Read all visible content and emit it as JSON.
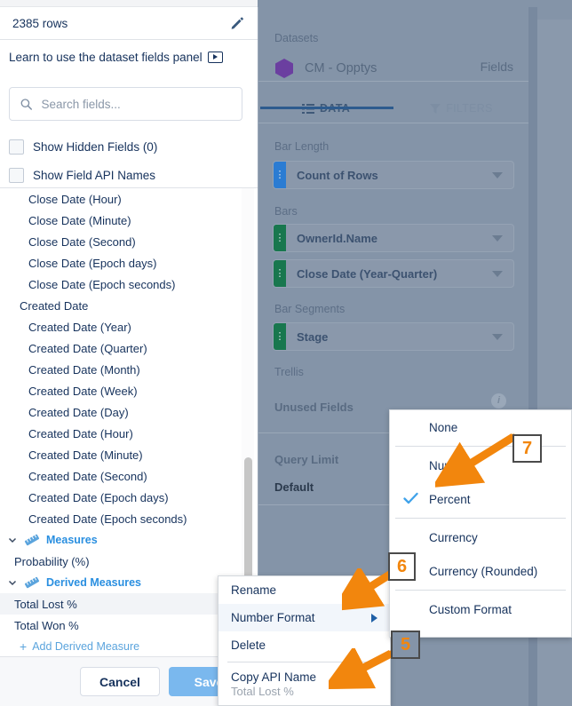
{
  "left_panel": {
    "rows_count": "2385 rows",
    "edit_icon": "pencil-icon",
    "learn_text": "Learn to use the dataset fields panel",
    "video_icon": "play-video-icon",
    "search": {
      "placeholder": "Search fields...",
      "value": "",
      "icon": "search-icon"
    },
    "checkboxes": [
      {
        "label": "Show Hidden Fields (0)",
        "checked": false
      },
      {
        "label": "Show Field API Names",
        "checked": false
      }
    ],
    "field_rows": [
      {
        "label": "Close Date (Hour)",
        "type": "item"
      },
      {
        "label": "Close Date (Minute)",
        "type": "item"
      },
      {
        "label": "Close Date (Second)",
        "type": "item"
      },
      {
        "label": "Close Date (Epoch days)",
        "type": "item"
      },
      {
        "label": "Close Date (Epoch seconds)",
        "type": "item"
      },
      {
        "label": "Created Date",
        "type": "parent"
      },
      {
        "label": "Created Date (Year)",
        "type": "item"
      },
      {
        "label": "Created Date (Quarter)",
        "type": "item"
      },
      {
        "label": "Created Date (Month)",
        "type": "item"
      },
      {
        "label": "Created Date (Week)",
        "type": "item"
      },
      {
        "label": "Created Date (Day)",
        "type": "item"
      },
      {
        "label": "Created Date (Hour)",
        "type": "item"
      },
      {
        "label": "Created Date (Minute)",
        "type": "item"
      },
      {
        "label": "Created Date (Second)",
        "type": "item"
      },
      {
        "label": "Created Date (Epoch days)",
        "type": "item"
      },
      {
        "label": "Created Date (Epoch seconds)",
        "type": "item"
      }
    ],
    "groups": [
      {
        "label": "Measures",
        "icon": "ruler-icon",
        "expanded": true
      },
      {
        "label": "Derived Measures",
        "icon": "ruler-icon",
        "expanded": true
      }
    ],
    "measures_items": [
      {
        "label": "Probability (%)",
        "selected": false
      }
    ],
    "derived_items": [
      {
        "label": "Total Lost %",
        "selected": true
      },
      {
        "label": "Total Won %",
        "selected": false
      }
    ],
    "add_derived_label": "Add Derived Measure",
    "footer": {
      "cancel_label": "Cancel",
      "save_label": "Save"
    },
    "scrollbar": "vertical-scrollbar"
  },
  "right_panel": {
    "datasets_label": "Datasets",
    "dataset_name": "CM - Opptys",
    "dataset_icon": "hexagon-dataset-icon",
    "fields_link": "Fields",
    "tabs": [
      {
        "label": "DATA",
        "icon": "list-icon",
        "active": true
      },
      {
        "label": "FILTERS",
        "icon": "funnel-icon",
        "active": false
      }
    ],
    "sections": [
      {
        "label": "Bar Length",
        "fields": [
          {
            "value": "Count of Rows",
            "handle_color": "#2b7cd3"
          }
        ]
      },
      {
        "label": "Bars",
        "fields": [
          {
            "value": "OwnerId.Name",
            "handle_color": "#18774e"
          },
          {
            "value": "Close Date (Year-Quarter)",
            "handle_color": "#18774e"
          }
        ]
      },
      {
        "label": "Bar Segments",
        "fields": [
          {
            "value": "Stage",
            "handle_color": "#18774e"
          }
        ]
      },
      {
        "label": "Trellis",
        "fields": []
      }
    ],
    "unused_fields_label": "Unused Fields",
    "unused_fields_info_icon": "info-icon",
    "query_limit_label": "Query Limit",
    "query_limit_value": "Default"
  },
  "context_menu": {
    "items": [
      {
        "label": "Rename",
        "highlighted": false,
        "has_submenu": false
      },
      {
        "label": "Number Format",
        "highlighted": true,
        "has_submenu": true
      },
      {
        "label": "Delete",
        "highlighted": false,
        "has_submenu": false
      }
    ],
    "copy_api_name_label": "Copy API Name",
    "copy_api_name_value": "Total Lost %"
  },
  "number_format_submenu": {
    "items": [
      {
        "label": "None",
        "checked": false
      },
      {
        "label": "Number",
        "checked": false
      },
      {
        "label": "Percent",
        "checked": true
      },
      {
        "label": "Currency",
        "checked": false
      },
      {
        "label": "Currency (Rounded)",
        "checked": false
      },
      {
        "label": "Custom Format",
        "checked": false
      }
    ],
    "check_icon": "checkmark-icon"
  },
  "callouts": [
    {
      "number": "5",
      "accent": "#f2860d"
    },
    {
      "number": "6",
      "accent": "#f2860d"
    },
    {
      "number": "7",
      "accent": "#f2860d"
    }
  ]
}
